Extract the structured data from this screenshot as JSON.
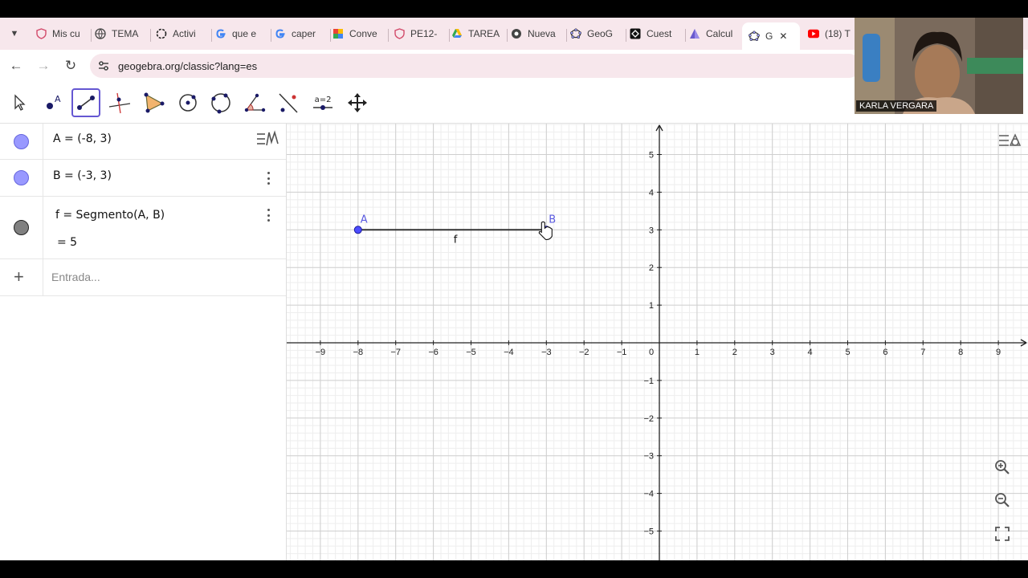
{
  "browser": {
    "tabs": [
      {
        "label": "Mis cu",
        "icon": "shield-icon"
      },
      {
        "label": "TEMA",
        "icon": "globe-icon"
      },
      {
        "label": "Activi",
        "icon": "openai-icon"
      },
      {
        "label": "que e",
        "icon": "google-icon"
      },
      {
        "label": "caper",
        "icon": "google-icon"
      },
      {
        "label": "Conve",
        "icon": "slides-icon"
      },
      {
        "label": "PE12-",
        "icon": "shield-icon"
      },
      {
        "label": "TAREA",
        "icon": "drive-icon"
      },
      {
        "label": "Nueva",
        "icon": "chrome-icon"
      },
      {
        "label": "GeoG",
        "icon": "geogebra-icon"
      },
      {
        "label": "Cuest",
        "icon": "quiz-icon"
      },
      {
        "label": "Calcul",
        "icon": "triangle-icon"
      },
      {
        "label": "G",
        "icon": "geogebra-icon",
        "active": true
      },
      {
        "label": "(18) T",
        "icon": "youtube-icon"
      }
    ],
    "url": "geogebra.org/classic?lang=es"
  },
  "webcam": {
    "name": "KARLA VERGARA"
  },
  "toolbar": {
    "tools": [
      "move-tool",
      "point-tool",
      "segment-tool",
      "perpendicular-tool",
      "polygon-tool",
      "circle-tool",
      "circle-three-points-tool",
      "angle-tool",
      "reflect-tool",
      "slider-tool",
      "move-view-tool"
    ],
    "slider_label": "a=2",
    "selected": "segment-tool"
  },
  "algebra": {
    "rows": [
      {
        "text": "A = (-8, 3)",
        "color": "#9999ff"
      },
      {
        "text": "B = (-3, 3)",
        "color": "#9999ff"
      },
      {
        "text": "f = Segmento(A, B)",
        "value": "= 5",
        "color": "#808080"
      }
    ],
    "input_placeholder": "Entrada..."
  },
  "colors": {
    "accent": "#6557d2",
    "point": "#4d4dff",
    "segment": "#333333"
  },
  "graphics": {
    "x_ticks": [
      "−9",
      "−8",
      "−7",
      "−6",
      "−5",
      "−4",
      "−3",
      "−2",
      "−1",
      "0",
      "1",
      "2",
      "3",
      "4",
      "5",
      "6",
      "7",
      "8",
      "9"
    ],
    "y_ticks": [
      "5",
      "4",
      "3",
      "2",
      "1",
      "−1",
      "−2",
      "−3",
      "−4",
      "−5"
    ],
    "point_a": {
      "label": "A",
      "x": -8,
      "y": 3
    },
    "point_b": {
      "label": "B",
      "x": -3,
      "y": 3
    },
    "segment_label": "f"
  }
}
